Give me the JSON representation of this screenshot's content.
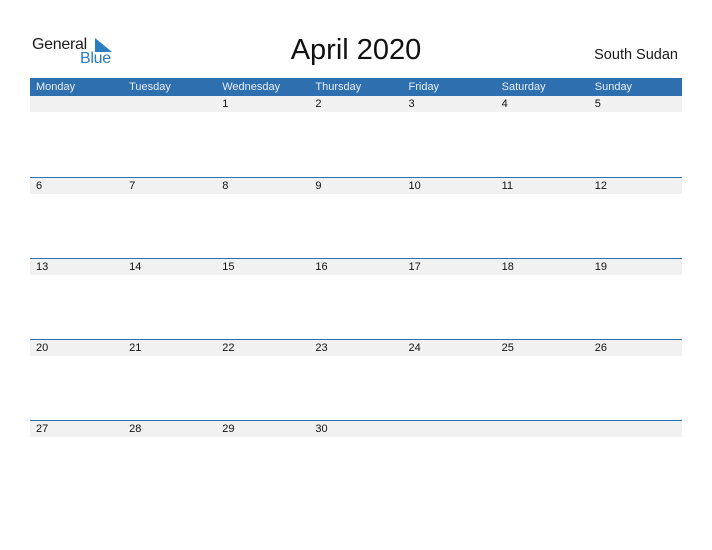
{
  "logo": {
    "general": "General",
    "blue": "Blue"
  },
  "title": "April 2020",
  "country": "South Sudan",
  "weekdays": [
    "Monday",
    "Tuesday",
    "Wednesday",
    "Thursday",
    "Friday",
    "Saturday",
    "Sunday"
  ],
  "weeks": [
    [
      "",
      "",
      "1",
      "2",
      "3",
      "4",
      "5"
    ],
    [
      "6",
      "7",
      "8",
      "9",
      "10",
      "11",
      "12"
    ],
    [
      "13",
      "14",
      "15",
      "16",
      "17",
      "18",
      "19"
    ],
    [
      "20",
      "21",
      "22",
      "23",
      "24",
      "25",
      "26"
    ],
    [
      "27",
      "28",
      "29",
      "30",
      "",
      "",
      ""
    ]
  ],
  "colors": {
    "header": "#2e6fb0",
    "accent": "#2a7dc0",
    "daybar": "#f1f1f1"
  }
}
